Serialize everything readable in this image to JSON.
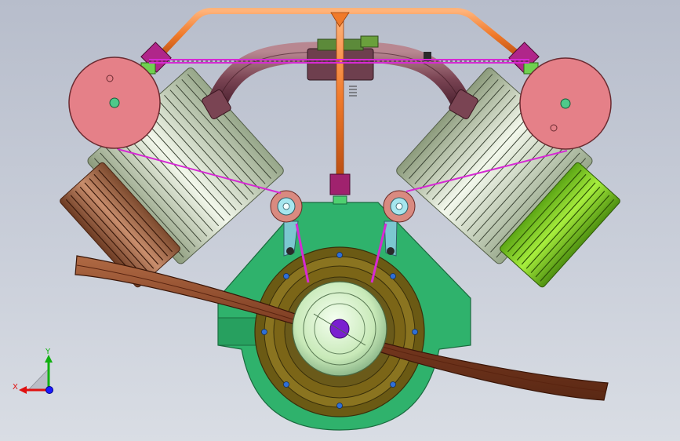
{
  "viewport": {
    "background_top": "#b7bdcb",
    "background_bottom": "#d9dde4"
  },
  "model": {
    "crankcase_color": "#2fb26c",
    "left_cylinder_color": "#b97b5c",
    "right_cylinder_color": "#8fdc25",
    "pulley_color": "#e58088",
    "pipe_color": "#f07a2a",
    "manifold_color": "#8a5460",
    "belt_color": "#d62ad4",
    "propeller_color": "#8a4a2a",
    "hub_color": "#d6f1c6"
  },
  "triad": {
    "x_label": "X",
    "y_label": "Y",
    "x_color": "#e01010",
    "y_color": "#10b010",
    "origin_color": "#1a1aff"
  }
}
